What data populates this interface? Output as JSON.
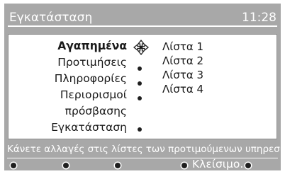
{
  "header": {
    "title": "Εγκατάσταση",
    "clock": "11:28"
  },
  "menu": {
    "items": [
      {
        "label": "Αγαπημένα",
        "selected": true
      },
      {
        "label": "Προτιμήσεις",
        "selected": false
      },
      {
        "label": "Πληροφορίες",
        "selected": false
      },
      {
        "label": "Περιορισμοί",
        "selected": false
      },
      {
        "label": "πρόσβασης",
        "selected": false
      },
      {
        "label": "Εγκατάσταση",
        "selected": false
      }
    ]
  },
  "options": [
    "Λίστα 1",
    "Λίστα 2",
    "Λίστα 3",
    "Λίστα 4"
  ],
  "hint": "Κάνετε αλλαγές στις λίστες των προτιμούμενων υπηρεσιών",
  "footer": {
    "close_label": "Κλείσιμο."
  },
  "colors": {
    "background": "#a8a8a8",
    "panel": "#ffffff",
    "text": "#1a1a1a",
    "header_text": "#ffffff"
  }
}
